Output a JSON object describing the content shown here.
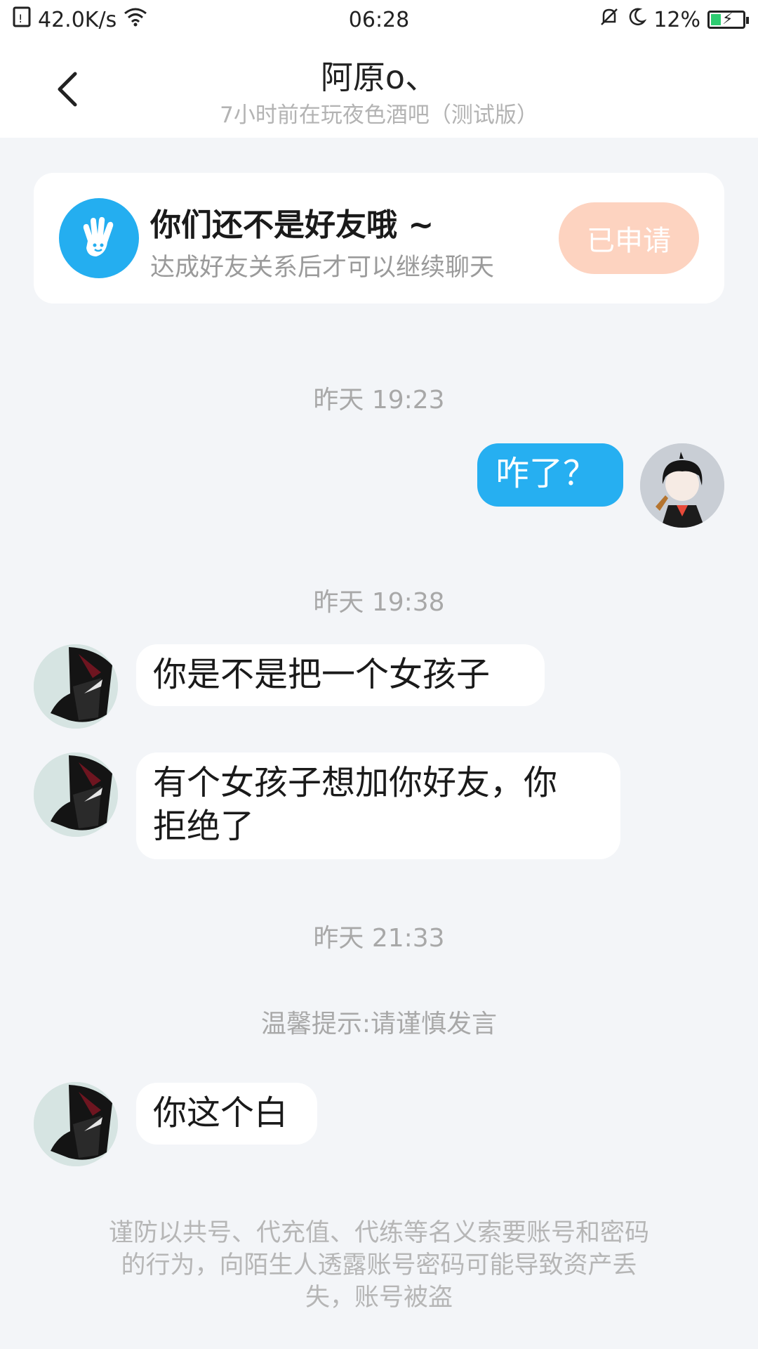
{
  "status_bar": {
    "speed": "42.0K/s",
    "time": "06:28",
    "battery": "12%",
    "icons": [
      "sim-icon",
      "wifi-icon",
      "mute-bell-icon",
      "moon-icon",
      "battery-icon"
    ]
  },
  "header": {
    "title": "阿原o、",
    "subtitle": "7小时前在玩夜色酒吧（测试版）",
    "back_icon": "chevron-left-icon"
  },
  "friend_card": {
    "title": "你们还不是好友哦 ~",
    "description": "达成好友关系后才可以继续聊天",
    "button_label": "已申请",
    "icon": "waving-hand-icon"
  },
  "messages": [
    {
      "type": "time",
      "text": "昨天 19:23"
    },
    {
      "type": "message",
      "sender": "self",
      "text": "咋了？"
    },
    {
      "type": "time",
      "text": "昨天 19:38"
    },
    {
      "type": "message",
      "sender": "other",
      "text": "你是不是把一个女孩子"
    },
    {
      "type": "message",
      "sender": "other",
      "text_line1": "有个女孩子想加你好友，你",
      "text_line2": "拒绝了"
    },
    {
      "type": "time",
      "text": "昨天 21:33"
    },
    {
      "type": "tip",
      "text": "温馨提示:请谨慎发言"
    },
    {
      "type": "message",
      "sender": "other",
      "text": "你这个白"
    }
  ],
  "warning": {
    "line1": "谨防以共号、代充值、代练等名义索要账号和密码",
    "line2": "的行为，向陌生人透露账号密码可能导致资产丢",
    "line3": "失，账号被盗"
  },
  "colors": {
    "accent": "#26aff1",
    "background": "#f3f5f8",
    "applied_button": "#fdd3c0",
    "muted_text": "#a8a8a8"
  }
}
